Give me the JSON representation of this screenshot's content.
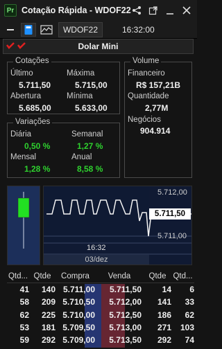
{
  "window": {
    "app_icon_label": "Pr",
    "title": "Cotação Rápida - WDOF22"
  },
  "toolbar": {
    "symbol": "WDOF22",
    "clock": "16:32:00"
  },
  "mode_button": "Dolar Mini",
  "cotacoes": {
    "legend": "Cotações",
    "ultimo_label": "Último",
    "ultimo_value": "5.711,50",
    "maxima_label": "Máxima",
    "maxima_value": "5.715,00",
    "abertura_label": "Abertura",
    "abertura_value": "5.685,00",
    "minima_label": "Mínima",
    "minima_value": "5.633,00"
  },
  "volume": {
    "legend": "Volume",
    "financeiro_label": "Financeiro",
    "financeiro_value": "R$ 157,21B",
    "quantidade_label": "Quantidade",
    "quantidade_value": "2,77M",
    "negocios_label": "Negócios",
    "negocios_value": "904.914"
  },
  "variacoes": {
    "legend": "Variações",
    "diaria_label": "Diária",
    "diaria_value": "0,50 %",
    "semanal_label": "Semanal",
    "semanal_value": "1,27 %",
    "mensal_label": "Mensal",
    "mensal_value": "1,28 %",
    "anual_label": "Anual",
    "anual_value": "8,58 %"
  },
  "chart": {
    "top_price": "5.712,00",
    "current_price": "5.711,50",
    "bottom_price": "5.711,00",
    "time_label": "16:32",
    "date_label": "03/dez"
  },
  "book": {
    "headers": [
      "Qtd...",
      "Qtde",
      "Compra",
      "Venda",
      "Qtde",
      "Qtd..."
    ],
    "rows": [
      {
        "ofb": "41",
        "qb": "140",
        "buy": "5.711,00",
        "sell": "5.711,50",
        "qs": "14",
        "ofs": "6"
      },
      {
        "ofb": "58",
        "qb": "209",
        "buy": "5.710,50",
        "sell": "5.712,00",
        "qs": "141",
        "ofs": "33"
      },
      {
        "ofb": "62",
        "qb": "225",
        "buy": "5.710,00",
        "sell": "5.712,50",
        "qs": "186",
        "ofs": "62"
      },
      {
        "ofb": "53",
        "qb": "181",
        "buy": "5.709,50",
        "sell": "5.713,00",
        "qs": "271",
        "ofs": "103"
      },
      {
        "ofb": "59",
        "qb": "292",
        "buy": "5.709,00",
        "sell": "5.713,50",
        "qs": "292",
        "ofs": "74"
      }
    ]
  },
  "colors": {
    "positive": "#2ed12e",
    "candle": "#22e022",
    "accent_blue": "#1e90ff"
  }
}
